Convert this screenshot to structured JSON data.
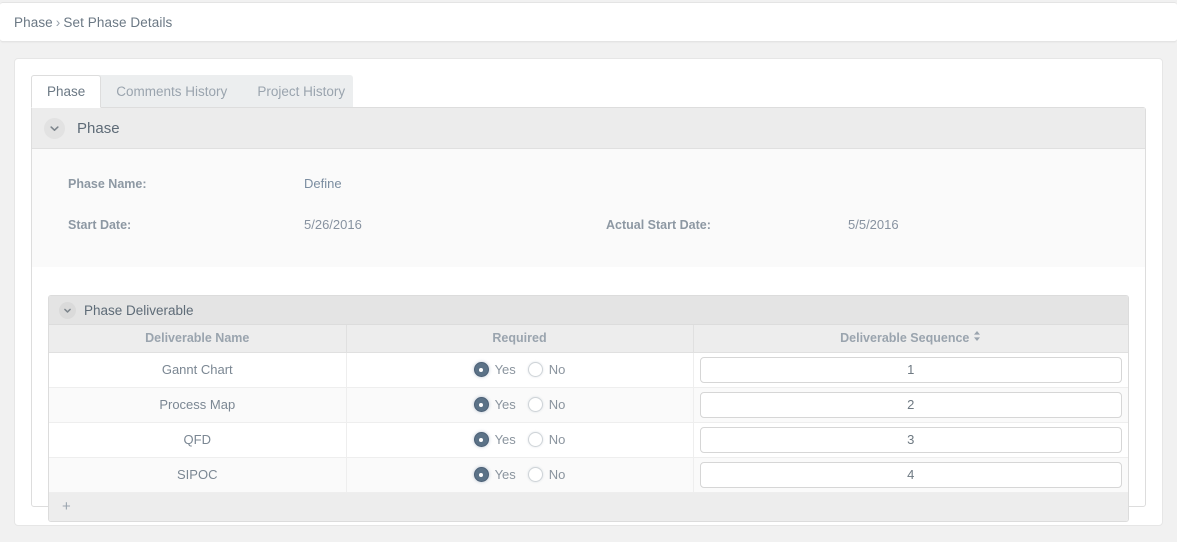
{
  "breadcrumb": {
    "root": "Phase",
    "separator": "›",
    "current": "Set Phase Details"
  },
  "tabs": [
    {
      "label": "Phase",
      "active": true
    },
    {
      "label": "Comments History",
      "active": false
    },
    {
      "label": "Project History",
      "active": false
    }
  ],
  "phase_section": {
    "title": "Phase",
    "collapse_icon": "chevron-down-icon",
    "fields": [
      {
        "label": "Phase Name:",
        "value": "Define"
      },
      {
        "label": "Start Date:",
        "value": "5/26/2016"
      },
      {
        "label": "Actual Start Date:",
        "value": "5/5/2016"
      }
    ]
  },
  "deliverable_section": {
    "title": "Phase Deliverable",
    "collapse_icon": "chevron-down-icon",
    "columns": [
      {
        "label": "Deliverable Name",
        "sortable": false
      },
      {
        "label": "Required",
        "sortable": false
      },
      {
        "label": "Deliverable Sequence",
        "sortable": true,
        "sort_icon": "sort-updown-icon"
      }
    ],
    "radio_options": {
      "yes": "Yes",
      "no": "No"
    },
    "rows": [
      {
        "name": "Gannt Chart",
        "required": "Yes",
        "sequence": "1"
      },
      {
        "name": "Process Map",
        "required": "Yes",
        "sequence": "2"
      },
      {
        "name": "QFD",
        "required": "Yes",
        "sequence": "3"
      },
      {
        "name": "SIPOC",
        "required": "Yes",
        "sequence": "4"
      }
    ],
    "add_row_label": "+"
  },
  "colors": {
    "page_background": "#f1f1f1",
    "panel_background": "#ffffff",
    "section_header": "#ececec",
    "subsection_header": "#e4e4e4",
    "table_header": "#ededed",
    "row_alt": "#fafafa",
    "text_muted": "#8a949e",
    "label": "#8d98a3",
    "radio_checked": "#5b7287",
    "border": "#dddddd"
  }
}
